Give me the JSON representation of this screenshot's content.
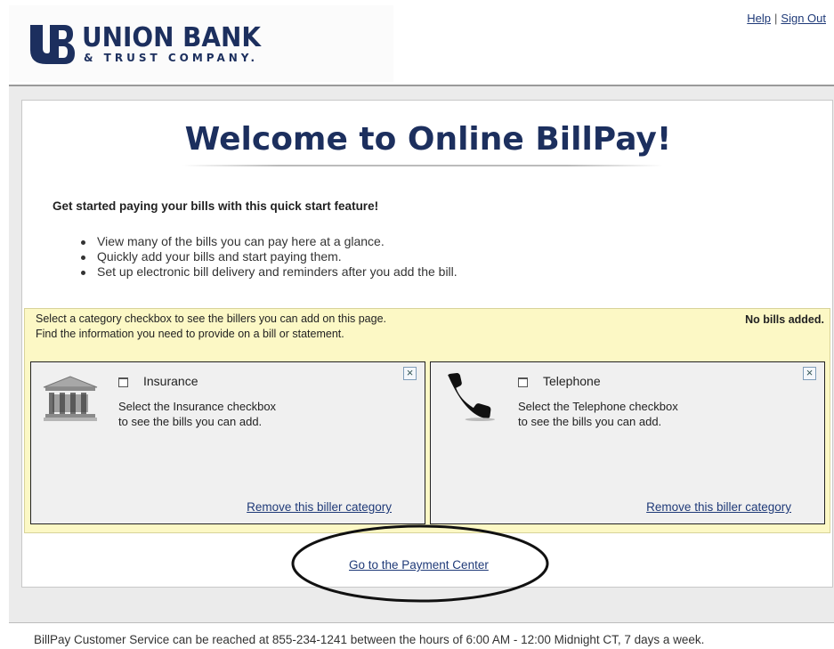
{
  "header": {
    "logo_name": "UNION BANK",
    "logo_sub": "& TRUST COMPANY.",
    "help_label": "Help",
    "separator": "|",
    "signout_label": "Sign Out"
  },
  "welcome": {
    "title": "Welcome to Online BillPay!",
    "intro": "Get started paying your bills with this quick start feature!",
    "bullets": [
      "View many of the bills you can pay here at a glance.",
      "Quickly add your bills and start paying them.",
      "Set up electronic bill delivery and reminders after you add the bill."
    ]
  },
  "categories_box": {
    "line1": "Select a category checkbox to see the billers you can add on this page.",
    "line2": "Find the information you need to provide on a bill or statement.",
    "status": "No bills added.",
    "cards": [
      {
        "icon": "bank-building-icon",
        "title": "Insurance",
        "description": "Select the Insurance checkbox\nto see the bills you can add.",
        "remove_label": "Remove this biller category",
        "close_glyph": "×"
      },
      {
        "icon": "telephone-handset-icon",
        "title": "Telephone",
        "description": "Select the Telephone checkbox\nto see the bills you can add.",
        "remove_label": "Remove this biller category",
        "close_glyph": "×"
      }
    ]
  },
  "payment_center_label": "Go to the Payment Center",
  "footer_text": "BillPay Customer Service can be reached at 855-234-1241 between the hours of 6:00 AM - 12:00 Midnight CT, 7 days a week.",
  "colors": {
    "brand_navy": "#1c2f5e",
    "link_blue": "#1f3a78",
    "highlight_yellow": "#fcf8c5"
  }
}
